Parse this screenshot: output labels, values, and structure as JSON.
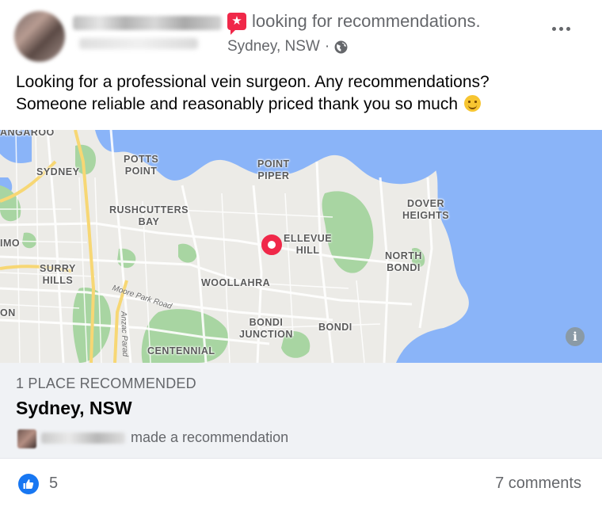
{
  "post": {
    "post_type": "looking for recommendations.",
    "location": "Sydney, NSW",
    "separator": "·",
    "privacy_icon": "globe-icon",
    "text_line1": "Looking for a professional vein surgeon. Any recommendations?",
    "text_line2": "Someone reliable and reasonably priced thank you so much"
  },
  "map": {
    "labels": {
      "kangaroo": "ANGAROO",
      "sydney": "SYDNEY",
      "potts_point": "POTTS\nPOINT",
      "point_piper": "POINT\nPIPER",
      "dover_heights": "DOVER\nHEIGHTS",
      "rushcutters_bay": "RUSHCUTTERS\nBAY",
      "bellevue_hill": "ELLEVUE\nHILL",
      "north_bondi": "NORTH\nBONDI",
      "imo": "IMO",
      "surry_hills": "SURRY\nHILLS",
      "woollahra": "WOOLLAHRA",
      "on": "ON",
      "bondi_junction": "BONDI\nJUNCTION",
      "bondi": "BONDI",
      "centennial": "CENTENNIAL"
    },
    "roads": {
      "moore_park": "Moore Park Road",
      "anzac": "Anzac Parad"
    },
    "info": "i"
  },
  "recommendation": {
    "count_label": "1 PLACE RECOMMENDED",
    "place": "Sydney, NSW",
    "action": "made a recommendation"
  },
  "footer": {
    "likes": "5",
    "comments": "7 comments"
  },
  "colors": {
    "accent": "#f02849",
    "like_blue": "#1877f2",
    "water": "#8ab4f8",
    "park": "#a8d5a2",
    "card_bg": "#f0f2f5"
  }
}
